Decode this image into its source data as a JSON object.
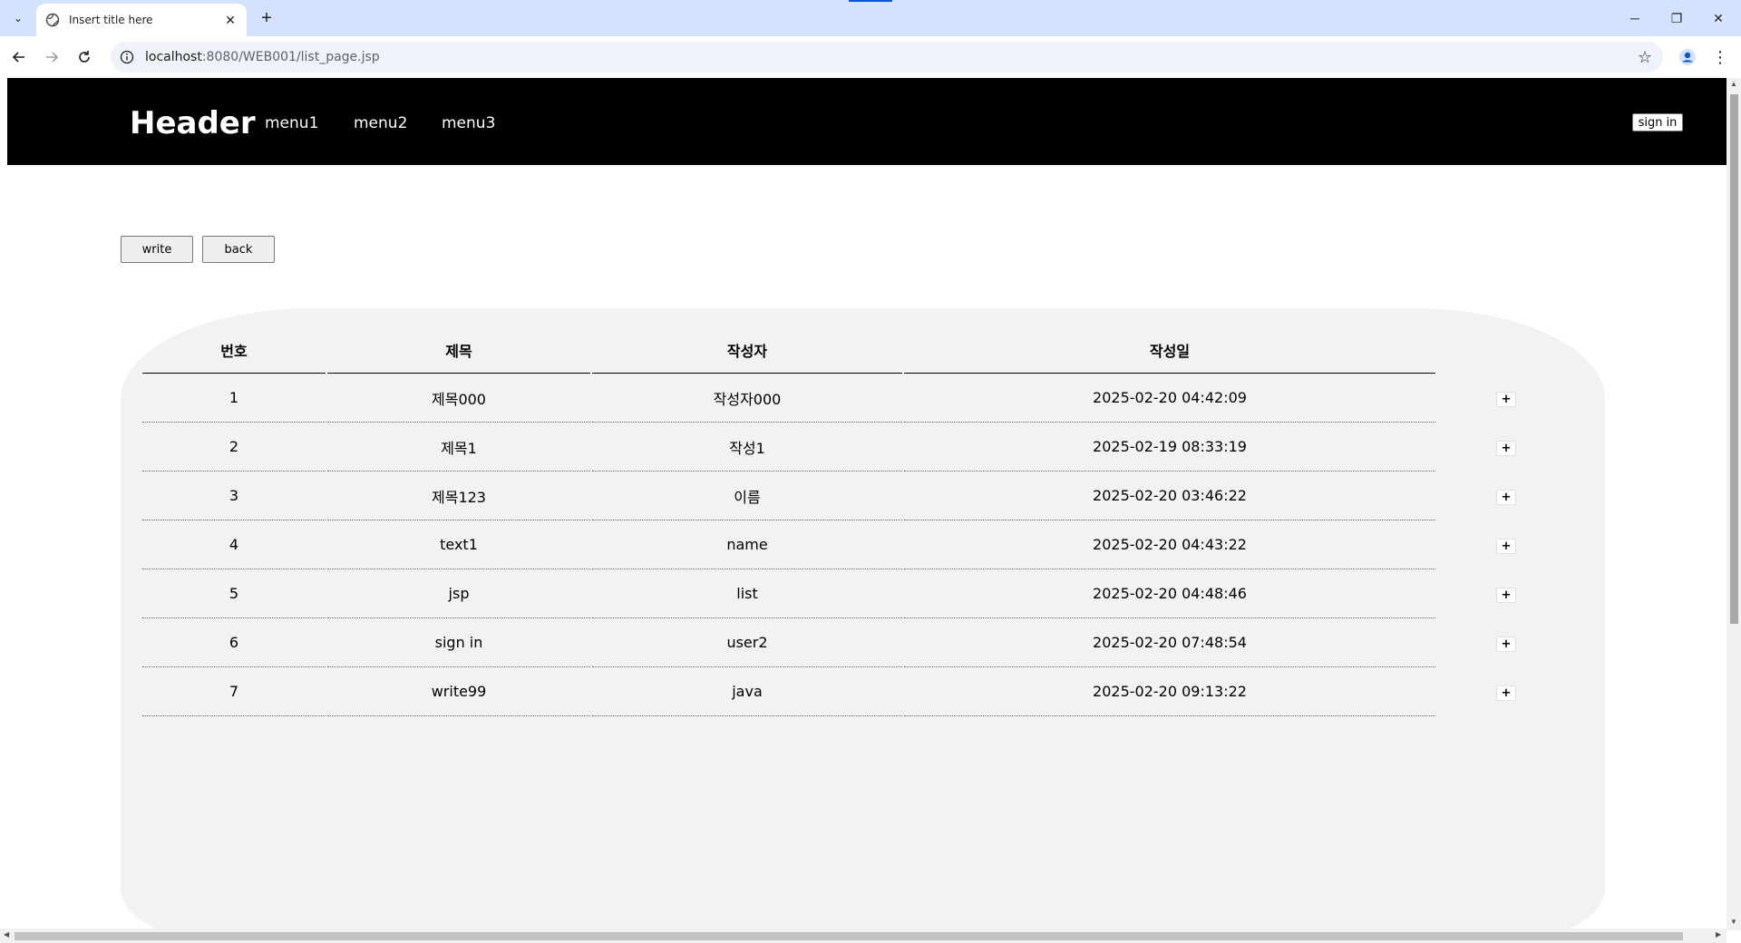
{
  "browser": {
    "tab_title": "Insert title here",
    "new_tab_icon": "+",
    "url_host": "localhost",
    "url_rest": ":8080/WEB001/list_page.jsp",
    "window_controls": {
      "minimize": "─",
      "restore": "❐",
      "close": "✕"
    }
  },
  "site": {
    "logo": "Header",
    "menus": [
      "menu1",
      "menu2",
      "menu3"
    ],
    "signin_label": "sign in"
  },
  "actions": {
    "write_label": "write",
    "back_label": "back"
  },
  "table": {
    "headers": {
      "no": "번호",
      "title": "제목",
      "writer": "작성자",
      "date": "작성일"
    },
    "plus_label": "+",
    "rows": [
      {
        "no": "1",
        "title": "제목000",
        "writer": "작성자000",
        "date": "2025-02-20 04:42:09"
      },
      {
        "no": "2",
        "title": "제목1",
        "writer": "작성1",
        "date": "2025-02-19 08:33:19"
      },
      {
        "no": "3",
        "title": "제목123",
        "writer": "이름",
        "date": "2025-02-20 03:46:22"
      },
      {
        "no": "4",
        "title": "text1",
        "writer": "name",
        "date": "2025-02-20 04:43:22"
      },
      {
        "no": "5",
        "title": "jsp",
        "writer": "list",
        "date": "2025-02-20 04:48:46"
      },
      {
        "no": "6",
        "title": "sign in",
        "writer": "user2",
        "date": "2025-02-20 07:48:54"
      },
      {
        "no": "7",
        "title": "write99",
        "writer": "java",
        "date": "2025-02-20 09:13:22"
      }
    ]
  },
  "colors": {
    "header_bg": "#000000",
    "board_bg": "#f2f2f2",
    "tabbar_bg": "#d3e3fd"
  }
}
